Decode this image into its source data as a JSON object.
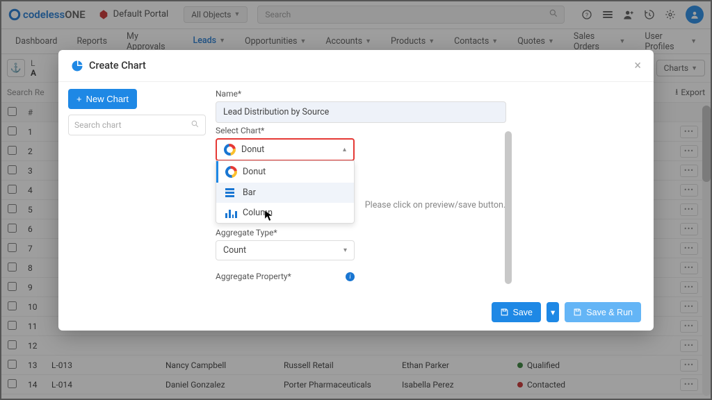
{
  "topbar": {
    "brand_prefix": "codeless",
    "brand_suffix": "ONE",
    "portal": "Default Portal",
    "objects": "All Objects",
    "search_ph": "Search"
  },
  "nav": {
    "items": [
      "Dashboard",
      "Reports",
      "My Approvals",
      "Leads",
      "Opportunities",
      "Accounts",
      "Products",
      "Contacts",
      "Quotes",
      "Sales Orders",
      "User Profiles"
    ],
    "active": 3,
    "has_caret": [
      false,
      false,
      false,
      true,
      true,
      true,
      true,
      true,
      true,
      true,
      true
    ]
  },
  "pagehdr": {
    "charts_btn": "Charts",
    "export_btn": "Export",
    "search_records": "Search Re"
  },
  "grid": {
    "rows": [
      {
        "n": "#",
        "id": "",
        "a": "",
        "b": "",
        "c": "",
        "status": "",
        "dot": ""
      },
      {
        "n": "1",
        "id": "",
        "a": "",
        "b": "",
        "c": "",
        "status": "",
        "dot": ""
      },
      {
        "n": "2",
        "id": "",
        "a": "",
        "b": "",
        "c": "",
        "status": "",
        "dot": ""
      },
      {
        "n": "3",
        "id": "",
        "a": "",
        "b": "",
        "c": "",
        "status": "",
        "dot": ""
      },
      {
        "n": "4",
        "id": "",
        "a": "",
        "b": "",
        "c": "",
        "status": "",
        "dot": ""
      },
      {
        "n": "5",
        "id": "",
        "a": "",
        "b": "",
        "c": "",
        "status": "",
        "dot": ""
      },
      {
        "n": "6",
        "id": "",
        "a": "",
        "b": "",
        "c": "",
        "status": "",
        "dot": ""
      },
      {
        "n": "7",
        "id": "",
        "a": "",
        "b": "",
        "c": "",
        "status": "",
        "dot": ""
      },
      {
        "n": "8",
        "id": "",
        "a": "",
        "b": "",
        "c": "",
        "status": "",
        "dot": ""
      },
      {
        "n": "9",
        "id": "",
        "a": "",
        "b": "",
        "c": "",
        "status": "",
        "dot": ""
      },
      {
        "n": "10",
        "id": "",
        "a": "",
        "b": "",
        "c": "",
        "status": "",
        "dot": ""
      },
      {
        "n": "11",
        "id": "",
        "a": "",
        "b": "",
        "c": "",
        "status": "",
        "dot": ""
      },
      {
        "n": "12",
        "id": "",
        "a": "",
        "b": "",
        "c": "",
        "status": "",
        "dot": ""
      },
      {
        "n": "13",
        "id": "L-013",
        "a": "Nancy Campbell",
        "b": "Russell Retail",
        "c": "Ethan Parker",
        "status": "Qualified",
        "dot": "g"
      },
      {
        "n": "14",
        "id": "L-014",
        "a": "Daniel Gonzalez",
        "b": "Porter Pharmaceuticals",
        "c": "Isabella Perez",
        "status": "Contacted",
        "dot": "r"
      }
    ]
  },
  "modal": {
    "title": "Create Chart",
    "new_chart": "New Chart",
    "search_chart_ph": "Search chart",
    "name_lbl": "Name*",
    "name_val": "Lead Distribution by Source",
    "select_chart_lbl": "Select Chart*",
    "select_chart_val": "Donut",
    "options": [
      {
        "label": "Donut",
        "icon": "donut"
      },
      {
        "label": "Bar",
        "icon": "bar"
      },
      {
        "label": "Column",
        "icon": "column"
      }
    ],
    "agg_type_lbl": "Aggregate Type*",
    "agg_type_val": "Count",
    "agg_prop_lbl": "Aggregate Property*",
    "preview_text": "Please click on preview/save button.",
    "save": "Save",
    "save_run": "Save & Run"
  }
}
